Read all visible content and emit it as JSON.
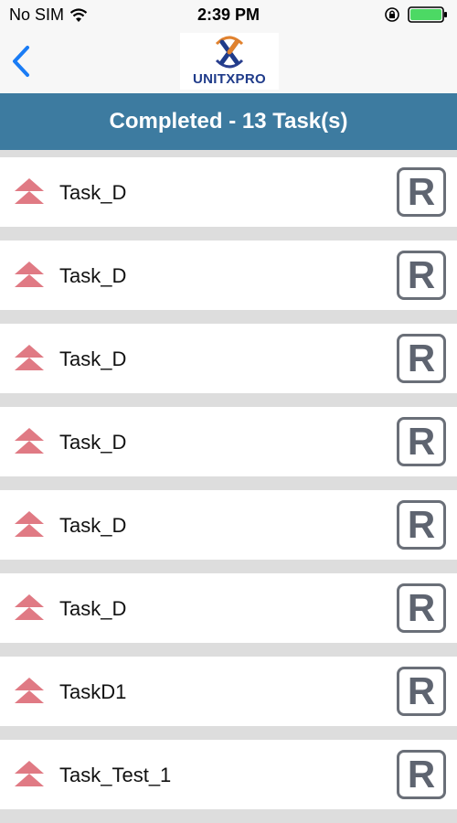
{
  "status_bar": {
    "carrier": "No SIM",
    "time": "2:39 PM",
    "wifi_icon": "wifi-icon",
    "rotation_lock_icon": "rotation-lock-icon",
    "battery_icon": "battery-icon",
    "battery_color": "#4cd964"
  },
  "nav": {
    "back_icon": "chevron-left-icon",
    "logo_text": "UNITXPRO"
  },
  "header": {
    "title": "Completed - 13 Task(s)",
    "color": "#3d7ba0"
  },
  "tasks": [
    {
      "name": "Task_D",
      "action": "R"
    },
    {
      "name": "Task_D",
      "action": "R"
    },
    {
      "name": "Task_D",
      "action": "R"
    },
    {
      "name": "Task_D",
      "action": "R"
    },
    {
      "name": "Task_D",
      "action": "R"
    },
    {
      "name": "Task_D",
      "action": "R"
    },
    {
      "name": "TaskD1",
      "action": "R"
    },
    {
      "name": "Task_Test_1",
      "action": "R"
    }
  ],
  "priority_icon": "double-chevron-up-icon",
  "priority_color": "#e07a84"
}
